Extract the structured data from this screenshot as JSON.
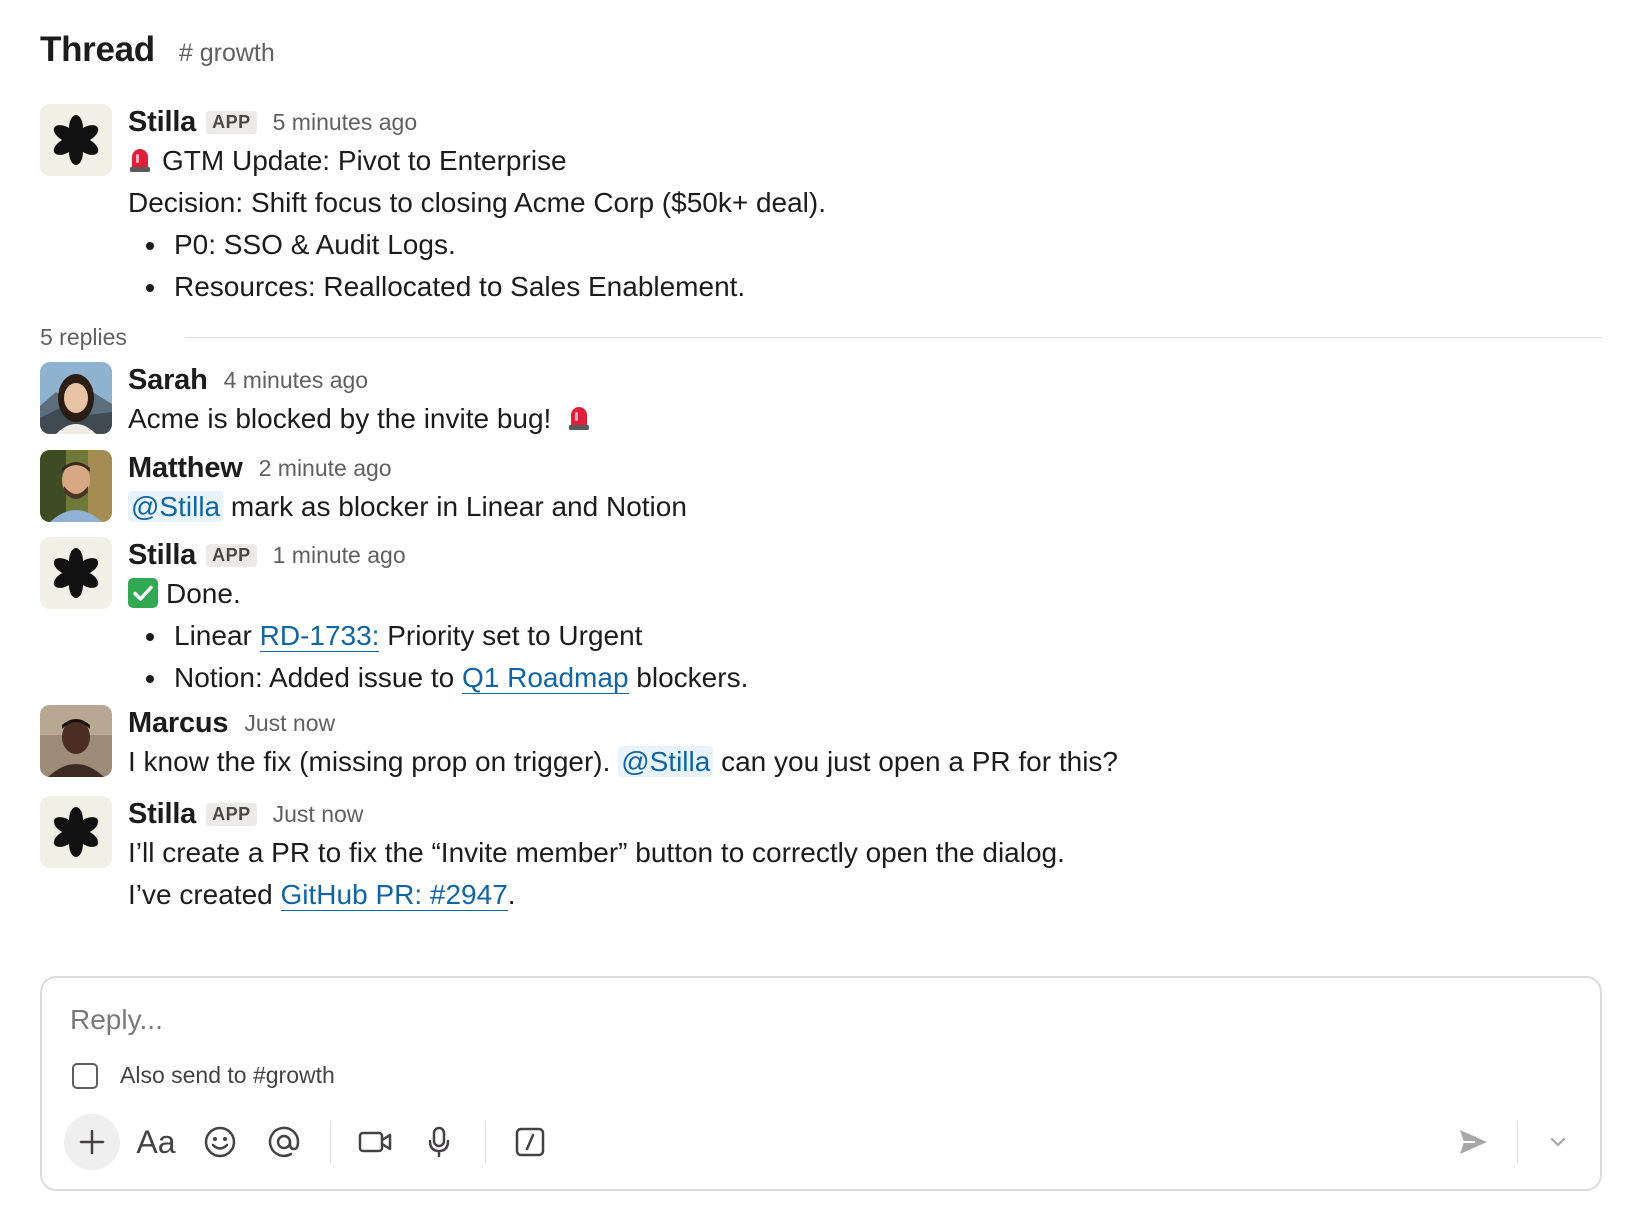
{
  "header": {
    "title": "Thread",
    "channel": "# growth"
  },
  "parent": {
    "name": "Stilla",
    "badge": "APP",
    "time": "5 minutes ago",
    "headline": "GTM Update: Pivot to Enterprise",
    "decision": "Decision: Shift focus to closing Acme Corp ($50k+ deal).",
    "bullets": [
      "P0: SSO & Audit Logs.",
      "Resources: Reallocated to Sales Enablement."
    ]
  },
  "replies_count": "5 replies",
  "replies": [
    {
      "name": "Sarah",
      "time": "4 minutes ago",
      "text": "Acme is blocked by the invite bug!"
    },
    {
      "name": "Matthew",
      "time": "2 minute ago",
      "mention": "@Stilla",
      "text": "mark as blocker in Linear and Notion"
    },
    {
      "name": "Stilla",
      "badge": "APP",
      "time": "1 minute ago",
      "text": "Done.",
      "b1_prefix": "Linear ",
      "b1_link": "RD-1733:",
      "b1_suffix": " Priority set to Urgent",
      "b2_prefix": "Notion: Added issue to ",
      "b2_link": "Q1 Roadmap",
      "b2_suffix": " blockers."
    },
    {
      "name": "Marcus",
      "time": "Just now",
      "text_before": "I know the fix (missing prop on trigger).",
      "mention": "@Stilla",
      "text_after": "can you just open a PR for this?"
    },
    {
      "name": "Stilla",
      "badge": "APP",
      "time": "Just now",
      "line1": "I’ll create a PR to fix the “Invite member” button to correctly open the dialog.",
      "line2_prefix": "I’ve created ",
      "line2_link": "GitHub PR: #2947",
      "line2_suffix": "."
    }
  ],
  "composer": {
    "placeholder": "Reply...",
    "also_send": "Also send to #growth",
    "aa_label": "Aa"
  },
  "icons": [
    "stilla-logo-icon",
    "siren-emoji-icon",
    "check-mark-emoji-icon",
    "plus-icon",
    "text-format-icon",
    "emoji-icon",
    "mention-icon",
    "video-icon",
    "microphone-icon",
    "slash-command-icon",
    "send-icon",
    "chevron-down-icon"
  ],
  "colors": {
    "link": "#1264a3",
    "mention_bg": "#e8f4fa",
    "app_avatar_bg": "#f1f0e6",
    "check_green": "#32a852",
    "siren_red": "#e01e3c"
  }
}
